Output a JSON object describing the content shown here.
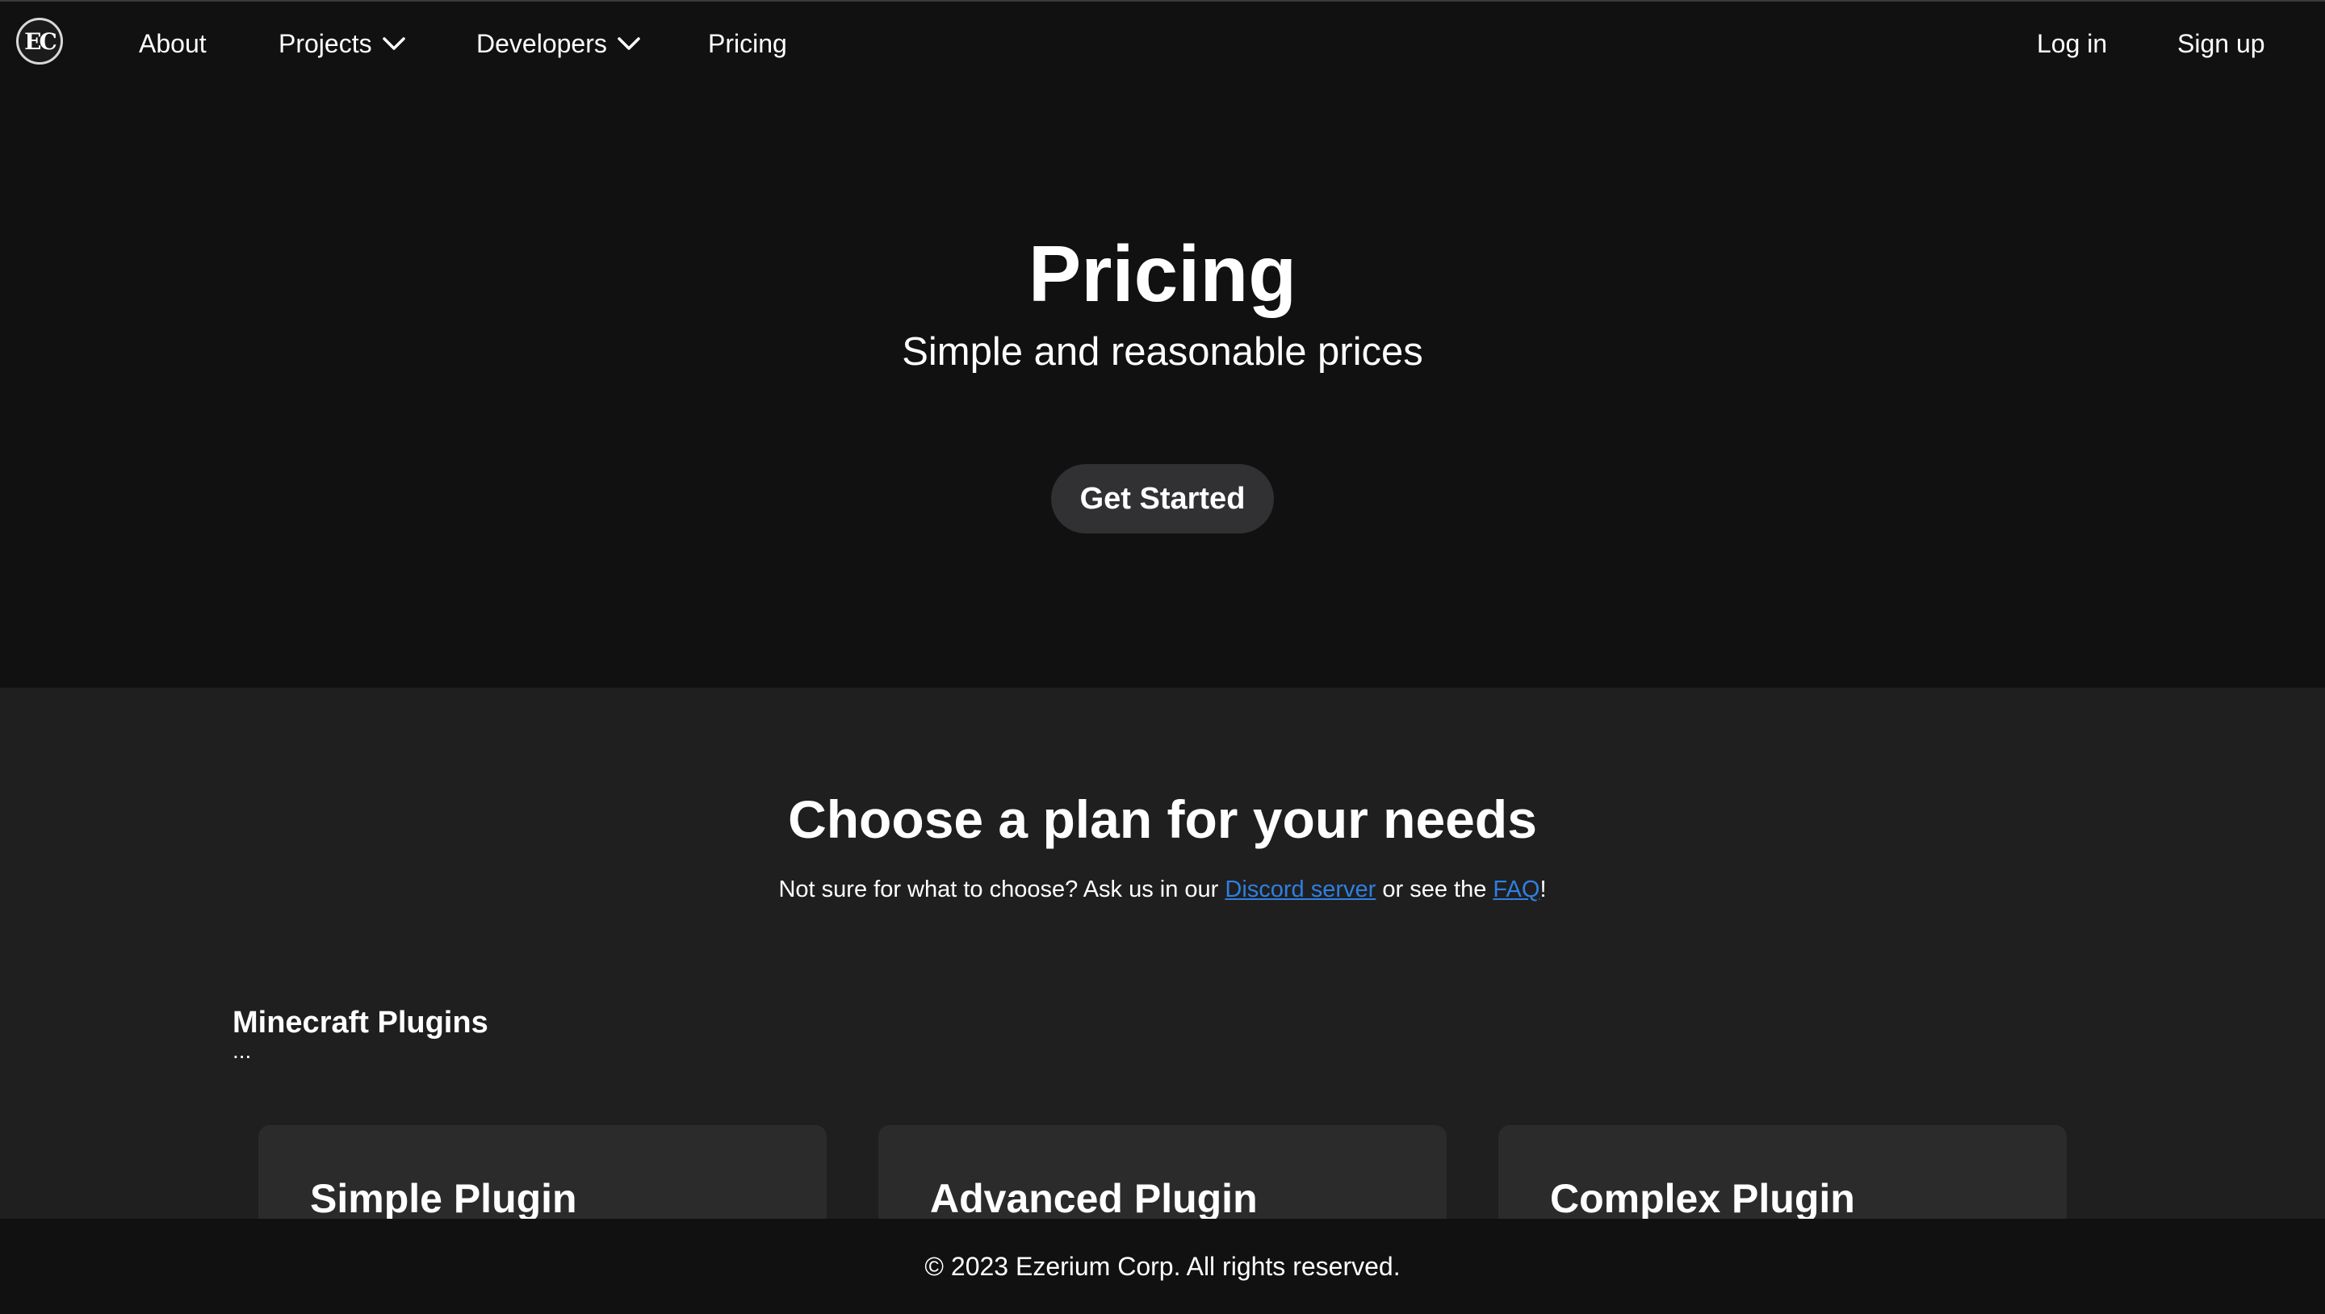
{
  "nav": {
    "logo_text": "EC",
    "items": [
      {
        "label": "About"
      },
      {
        "label": "Projects",
        "icon": "chevron-down-icon"
      },
      {
        "label": "Developers",
        "icon": "chevron-down-icon"
      },
      {
        "label": "Pricing"
      }
    ],
    "login_label": "Log in",
    "signup_label": "Sign up"
  },
  "hero": {
    "title": "Pricing",
    "subtitle": "Simple and reasonable prices",
    "cta_label": "Get Started"
  },
  "plans": {
    "title": "Choose a plan for your needs",
    "note_before": "Not sure for what to choose? Ask us in our ",
    "discord_link": "Discord server",
    "note_middle": " or see the ",
    "faq_link": "FAQ",
    "note_after": "!",
    "category": {
      "title": "Minecraft Plugins",
      "description": "..."
    },
    "cards": [
      {
        "title": "Simple Plugin"
      },
      {
        "title": "Advanced Plugin"
      },
      {
        "title": "Complex Plugin"
      }
    ]
  },
  "footer": {
    "text": "© 2023 Ezerium Corp. All rights reserved."
  },
  "colors": {
    "background": "#111112",
    "section": "#1f1f20",
    "card": "#2b2b2c",
    "button": "#313133",
    "link": "#2f7fe0"
  }
}
